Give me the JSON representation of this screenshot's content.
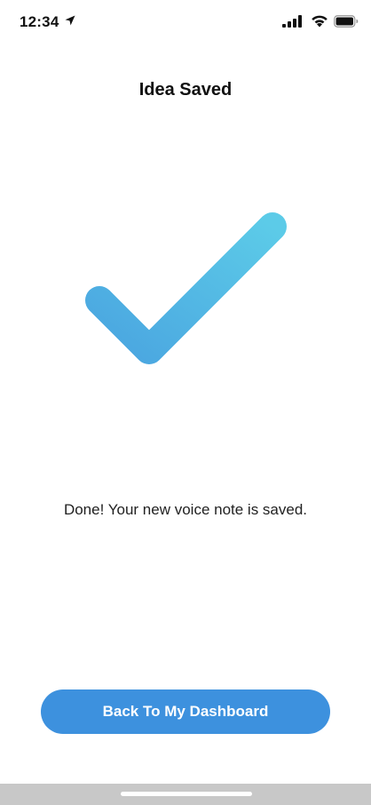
{
  "status_bar": {
    "time": "12:34"
  },
  "header": {
    "title": "Idea Saved"
  },
  "main": {
    "message": "Done!  Your new voice note is saved.",
    "icon": "checkmark-icon"
  },
  "actions": {
    "back_label": "Back To My Dashboard"
  },
  "colors": {
    "accent": "#3d91de",
    "check_gradient_start": "#4aa5e0",
    "check_gradient_end": "#5ccbe8"
  }
}
